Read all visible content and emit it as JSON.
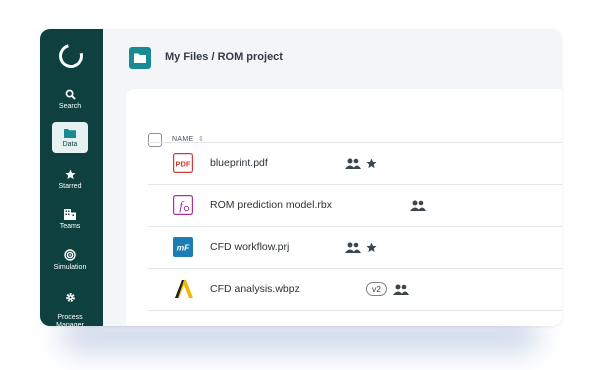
{
  "sidebar": {
    "items": [
      {
        "label": "Search",
        "icon": "search-icon"
      },
      {
        "label": "Data",
        "icon": "folder-icon",
        "active": true
      },
      {
        "label": "Starred",
        "icon": "star-icon"
      },
      {
        "label": "Teams",
        "icon": "building-icon"
      },
      {
        "label": "Simulation",
        "icon": "simulation-icon"
      },
      {
        "label": "Process\nManager",
        "icon": "gear-icon"
      }
    ]
  },
  "header": {
    "breadcrumb": "My Files / ROM project"
  },
  "table": {
    "name_header": "NAME",
    "rows": [
      {
        "name": "blueprint.pdf",
        "icon": "pdf-file-icon",
        "icon_text": "PDF",
        "shared": true,
        "starred": true,
        "version": ""
      },
      {
        "name": "ROM prediction model.rbx",
        "icon": "rbx-file-icon",
        "icon_text": "f",
        "shared": true,
        "starred": false,
        "version": ""
      },
      {
        "name": "CFD workflow.prj",
        "icon": "modelfrontier-file-icon",
        "icon_text": "mF",
        "shared": true,
        "starred": true,
        "version": ""
      },
      {
        "name": "CFD analysis.wbpz",
        "icon": "ansys-file-icon",
        "icon_text": "",
        "shared": true,
        "starred": false,
        "version": "v2"
      }
    ]
  },
  "colors": {
    "sidebar_bg": "#0e4040",
    "accent_teal": "#1a8b94",
    "pdf_red": "#d23a3a",
    "rbx_purple": "#a8339b",
    "mf_blue": "#1b7fb3",
    "ansys_yellow": "#f2b705"
  }
}
